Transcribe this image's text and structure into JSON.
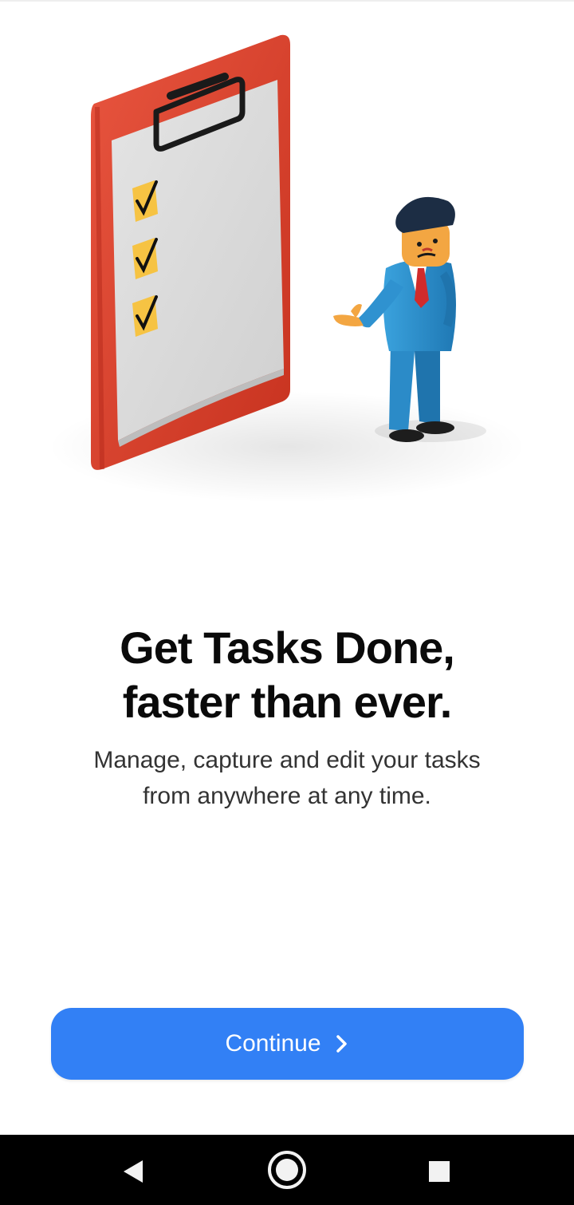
{
  "onboarding": {
    "headline_line1": "Get Tasks Done,",
    "headline_line2": "faster than ever.",
    "subtitle_line1": "Manage, capture and edit your tasks",
    "subtitle_line2": "from anywhere at any time.",
    "continue_label": "Continue"
  },
  "icons": {
    "continue": "chevron-right-icon",
    "back": "back-triangle-icon",
    "home": "home-circle-icon",
    "recents": "recents-square-icon"
  },
  "colors": {
    "primary_button": "#3280f5",
    "clipboard_red": "#e0412e",
    "checkbox_yellow": "#f6c343",
    "suit_blue": "#2e93d1",
    "navbar": "#000000"
  }
}
